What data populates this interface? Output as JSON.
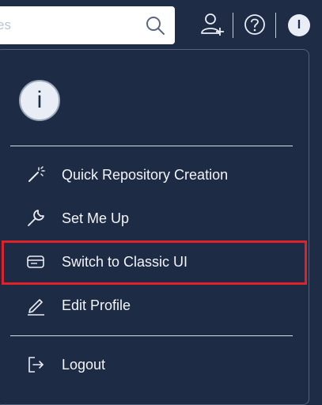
{
  "header": {
    "search": {
      "placeholder": "es"
    },
    "icons": [
      "search-icon",
      "add-user-icon",
      "help-icon"
    ],
    "avatar_initial": "I"
  },
  "menu": {
    "avatar_initial": "i",
    "items": [
      {
        "label": "Quick Repository Creation",
        "icon": "magic-wand-icon"
      },
      {
        "label": "Set Me Up",
        "icon": "wrench-icon"
      },
      {
        "label": "Switch to Classic UI",
        "icon": "classic-ui-icon",
        "highlighted": true
      },
      {
        "label": "Edit Profile",
        "icon": "pencil-icon"
      },
      {
        "label": "Logout",
        "icon": "logout-icon"
      }
    ]
  },
  "colors": {
    "background": "#1f2c45",
    "menu_background": "#1e2b44",
    "text": "#f2f5fa",
    "highlight": "#e0212a",
    "search_background": "#ffffff"
  }
}
